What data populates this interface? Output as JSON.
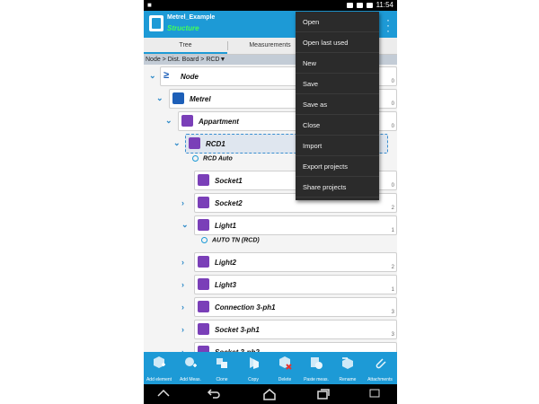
{
  "status": {
    "time": "11:54"
  },
  "app": {
    "title": "Metrel_Example",
    "subtitle": "Structure"
  },
  "tabs": [
    {
      "label": "Tree"
    },
    {
      "label": "Measurements"
    }
  ],
  "breadcrumb": "Node > Dist. Board > RCD▼",
  "tree": [
    {
      "label": "Node",
      "num": "0",
      "icon": "node-icon"
    },
    {
      "label": "Metrel",
      "num": "0",
      "icon": "metrel-icon"
    },
    {
      "label": "Appartment",
      "num": "0",
      "icon": "apartment-icon"
    },
    {
      "label": "RCD1",
      "num": "",
      "icon": "rcd-icon"
    },
    {
      "label": "Socket1",
      "num": "0",
      "icon": "socket-icon"
    },
    {
      "label": "Socket2",
      "num": "2",
      "icon": "socket-icon"
    },
    {
      "label": "Light1",
      "num": "1",
      "icon": "light-icon"
    },
    {
      "label": "Light2",
      "num": "2",
      "icon": "light-icon"
    },
    {
      "label": "Light3",
      "num": "1",
      "icon": "light-icon"
    },
    {
      "label": "Connection 3-ph1",
      "num": "3",
      "icon": "connection-icon"
    },
    {
      "label": "Socket 3-ph1",
      "num": "3",
      "icon": "socket3ph-icon"
    },
    {
      "label": "Socket 3-ph2",
      "num": "",
      "icon": "socket3ph-icon"
    }
  ],
  "measurements": [
    {
      "label": "RCD Auto"
    },
    {
      "label": "AUTO TN (RCD)"
    }
  ],
  "menu": [
    {
      "label": "Open"
    },
    {
      "label": "Open last used"
    },
    {
      "label": "New"
    },
    {
      "label": "Save"
    },
    {
      "label": "Save as"
    },
    {
      "label": "Close"
    },
    {
      "label": "Import"
    },
    {
      "label": "Export projects"
    },
    {
      "label": "Share projects"
    }
  ],
  "toolbar": [
    {
      "label": "Add element"
    },
    {
      "label": "Add Meas."
    },
    {
      "label": "Clone"
    },
    {
      "label": "Copy"
    },
    {
      "label": "Delete"
    },
    {
      "label": "Paste meas."
    },
    {
      "label": "Rename"
    },
    {
      "label": "Attachments"
    }
  ],
  "colors": {
    "accent": "#1d9ad6",
    "menu_bg": "#2b2b2b",
    "icon_purple": "#7a3fb8"
  }
}
